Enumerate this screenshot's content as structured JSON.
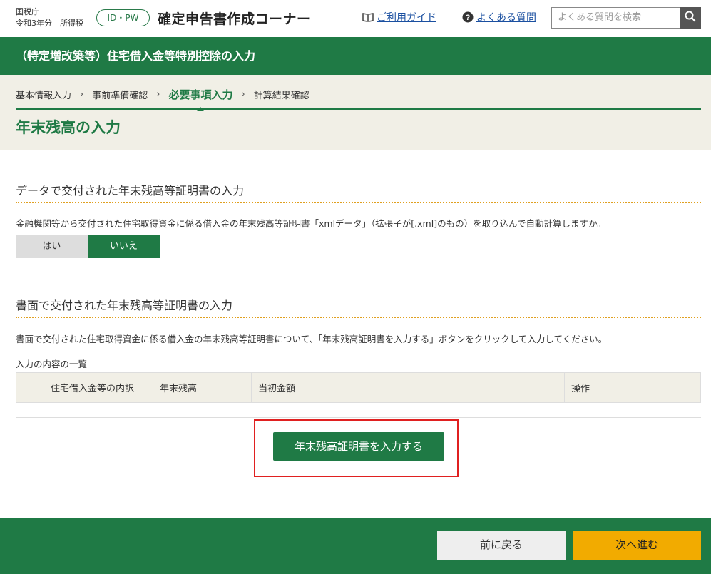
{
  "header": {
    "agency": "国税庁",
    "year_label": "令和3年分　所得税",
    "idpw_badge": "ID・PW",
    "app_title": "確定申告書作成コーナー",
    "guide_link": "ご利用ガイド",
    "faq_link": "よくある質問",
    "search_placeholder": "よくある質問を検索",
    "icons": [
      "book-icon",
      "question-icon",
      "search-icon"
    ]
  },
  "title_band": "（特定増改築等）住宅借入金等特別控除の入力",
  "steps": [
    "基本情報入力",
    "事前準備確認",
    "必要事項入力",
    "計算結果確認"
  ],
  "page_title": "年末残高の入力",
  "section_data": {
    "heading": "データで交付された年末残高等証明書の入力",
    "description": "金融機関等から交付された住宅取得資金に係る借入金の年末残高等証明書「xmlデータ」（拡張子が[.xml]のもの）を取り込んで自動計算しますか。",
    "option_yes": "はい",
    "option_no": "いいえ",
    "selected": "いいえ"
  },
  "section_paper": {
    "heading": "書面で交付された年末残高等証明書の入力",
    "description": "書面で交付された住宅取得資金に係る借入金の年末残高等証明書について、「年末残高証明書を入力する」ボタンをクリックして入力してください。",
    "list_label": "入力の内容の一覧",
    "columns": [
      "",
      "住宅借入金等の内訳",
      "年末残高",
      "当初金額",
      "操作"
    ],
    "input_button": "年末残高証明書を入力する"
  },
  "footer": {
    "back": "前に戻る",
    "next": "次へ進む"
  },
  "colors": {
    "brand_green": "#1f7a45",
    "next_yellow": "#f2ab00",
    "highlight_red": "#e02020"
  }
}
